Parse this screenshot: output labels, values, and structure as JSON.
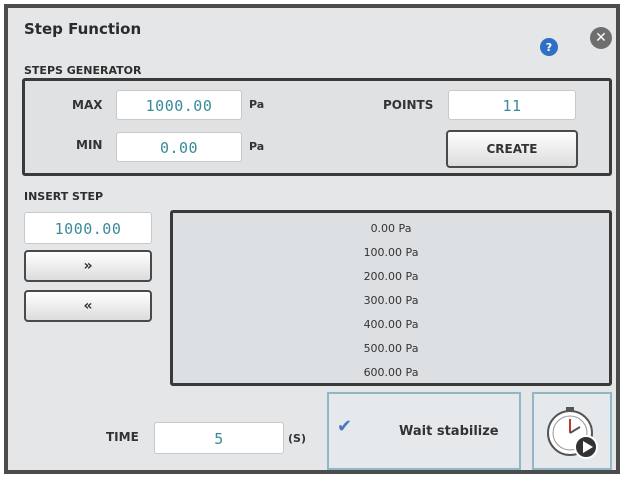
{
  "window": {
    "title": "Step Function"
  },
  "steps_generator": {
    "label": "STEPS GENERATOR",
    "max_label": "MAX",
    "max_value": "1000.00",
    "max_unit": "Pa",
    "min_label": "MIN",
    "min_value": "0.00",
    "min_unit": "Pa",
    "points_label": "POINTS",
    "points_value": "11",
    "create_label": "CREATE"
  },
  "insert_step": {
    "label": "INSERT STEP",
    "value": "1000.00",
    "add_label": "»",
    "remove_label": "«"
  },
  "steps_list": [
    "0.00 Pa",
    "100.00 Pa",
    "200.00 Pa",
    "300.00 Pa",
    "400.00 Pa",
    "500.00 Pa",
    "600.00 Pa"
  ],
  "footer": {
    "time_label": "TIME",
    "time_value": "5",
    "time_unit": "(S)",
    "wait_label": "Wait stabilize",
    "wait_checked": true
  },
  "icons": {
    "help": "help-icon",
    "close": "close-icon",
    "check": "check-icon",
    "play": "stopwatch-play-icon"
  },
  "colors": {
    "field_text": "#3a8a9a",
    "accent_border": "#8fb7c8",
    "help_blue": "#2f6fc4"
  }
}
